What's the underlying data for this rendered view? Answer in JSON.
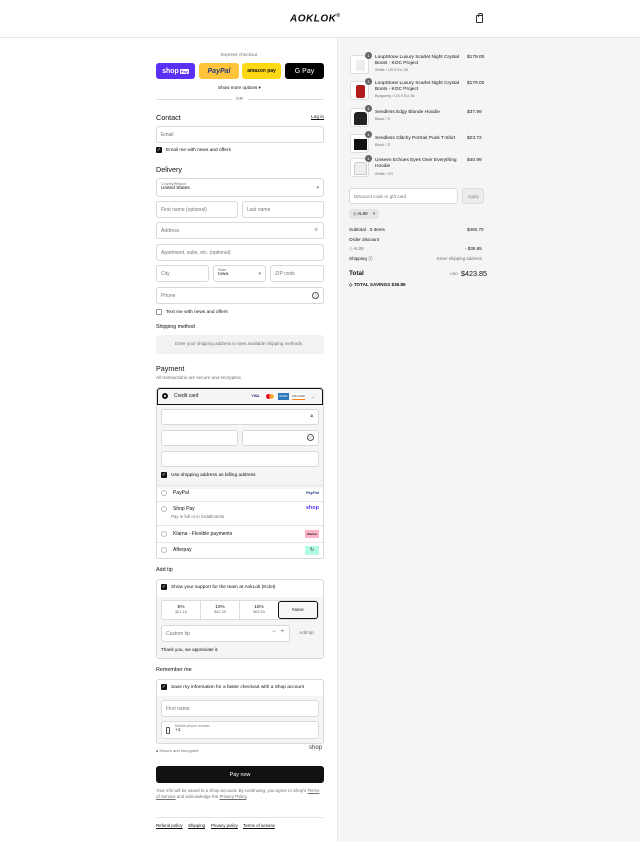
{
  "header": {
    "logo": "AOKLOK",
    "logo_mark": "®"
  },
  "express": {
    "label": "Express checkout",
    "shop": "shop",
    "shop_pay": "Pay",
    "paypal": "PayPal",
    "amazon": "amazon pay",
    "gpay": "G Pay",
    "show_more": "Show more options",
    "or": "OR"
  },
  "contact": {
    "title": "Contact",
    "login": "Log in",
    "email_placeholder": "Email",
    "email_news": "Email me with news and offers"
  },
  "delivery": {
    "title": "Delivery",
    "country_label": "Country/Region",
    "country": "United States",
    "first_name": "First name (optional)",
    "last_name": "Last name",
    "address": "Address",
    "apartment": "Apartment, suite, etc. (optional)",
    "city": "City",
    "state_label": "State",
    "state": "Iowa",
    "zip": "ZIP code",
    "phone": "Phone",
    "text_news": "Text me with news and offers"
  },
  "shipping": {
    "title": "Shipping method",
    "note": "Enter your shipping address to view available shipping methods."
  },
  "payment": {
    "title": "Payment",
    "subtitle": "All transactions are secure and encrypted.",
    "credit_card": "Credit card",
    "cards": [
      "VISA",
      "MC",
      "AMEX",
      "DISCOVER"
    ],
    "billing_same": "Use shipping address as billing address",
    "methods": [
      {
        "label": "PayPal",
        "sub": "",
        "badge": "PayPal",
        "color": "#253b80"
      },
      {
        "label": "Shop Pay",
        "sub": "Pay in full or in installments",
        "badge": "shop",
        "color": "#5a31f4"
      },
      {
        "label": "Klarna - Flexible payments",
        "sub": "",
        "badge": "Klarna",
        "color": "#ffb3c7"
      },
      {
        "label": "Afterpay",
        "sub": "",
        "badge": "↻",
        "color": "#b2fce4"
      }
    ]
  },
  "tip": {
    "title": "Add tip",
    "support": "Show your support for the team at AokLok (Kclot)",
    "options": [
      {
        "pct": "5%",
        "amt": "$21.18"
      },
      {
        "pct": "10%",
        "amt": "$42.35"
      },
      {
        "pct": "15%",
        "amt": "$63.53"
      }
    ],
    "none": "None",
    "custom": "Custom tip",
    "add": "Add tip",
    "thanks": "Thank you, we appreciate it."
  },
  "remember": {
    "title": "Remember me",
    "save": "Save my information for a faster checkout with a Shop account",
    "first_name": "First name",
    "mobile_label": "Mobile phone number",
    "mobile": "+1",
    "secure": "Secure and encrypted",
    "shop": "shop"
  },
  "pay": {
    "button": "Pay now",
    "note1": "Your info will be saved to a Shop account. By continuing, you agree to Shop's",
    "tos": "Terms of Service",
    "note2": "and acknowledge the",
    "privacy": "Privacy Policy"
  },
  "footer": {
    "links": [
      "Refund policy",
      "Shipping",
      "Privacy policy",
      "Terms of service"
    ]
  },
  "cart": {
    "items": [
      {
        "name": "LoopStone Luxury Scarlet Night Crystal Boots - KOC Project",
        "variant": "White / US 5 EU 36",
        "price": "$179.00",
        "qty": "1"
      },
      {
        "name": "LoopStone Luxury Scarlet Night Crystal Boots - KOC Project",
        "variant": "Burgundy / US 5 EU 36",
        "price": "$179.00",
        "qty": "1"
      },
      {
        "name": "Sendless Edgy Blonde Hoodie",
        "variant": "Black / S",
        "price": "$37.99",
        "qty": "1"
      },
      {
        "name": "Sendless Glitchy Portrait Punk T-Shirt",
        "variant": "Black / S",
        "price": "$23.72",
        "qty": "1"
      },
      {
        "name": "Unseen Echoes Eyes Over Everything Hoodie",
        "variant": "White / XS",
        "price": "$40.99",
        "qty": "1"
      }
    ],
    "discount_placeholder": "Discount code or gift card",
    "apply": "Apply",
    "code": "AL09",
    "subtotal_label": "Subtotal · 5 items",
    "subtotal": "$460.70",
    "order_discount": "Order discount",
    "discount_code": "AL09",
    "discount_amt": "- $36.85",
    "shipping_label": "Shipping",
    "shipping_val": "Enter shipping address",
    "total_label": "Total",
    "currency": "USD",
    "total": "$423.85",
    "savings_label": "TOTAL SAVINGS",
    "savings": "$36.85"
  }
}
